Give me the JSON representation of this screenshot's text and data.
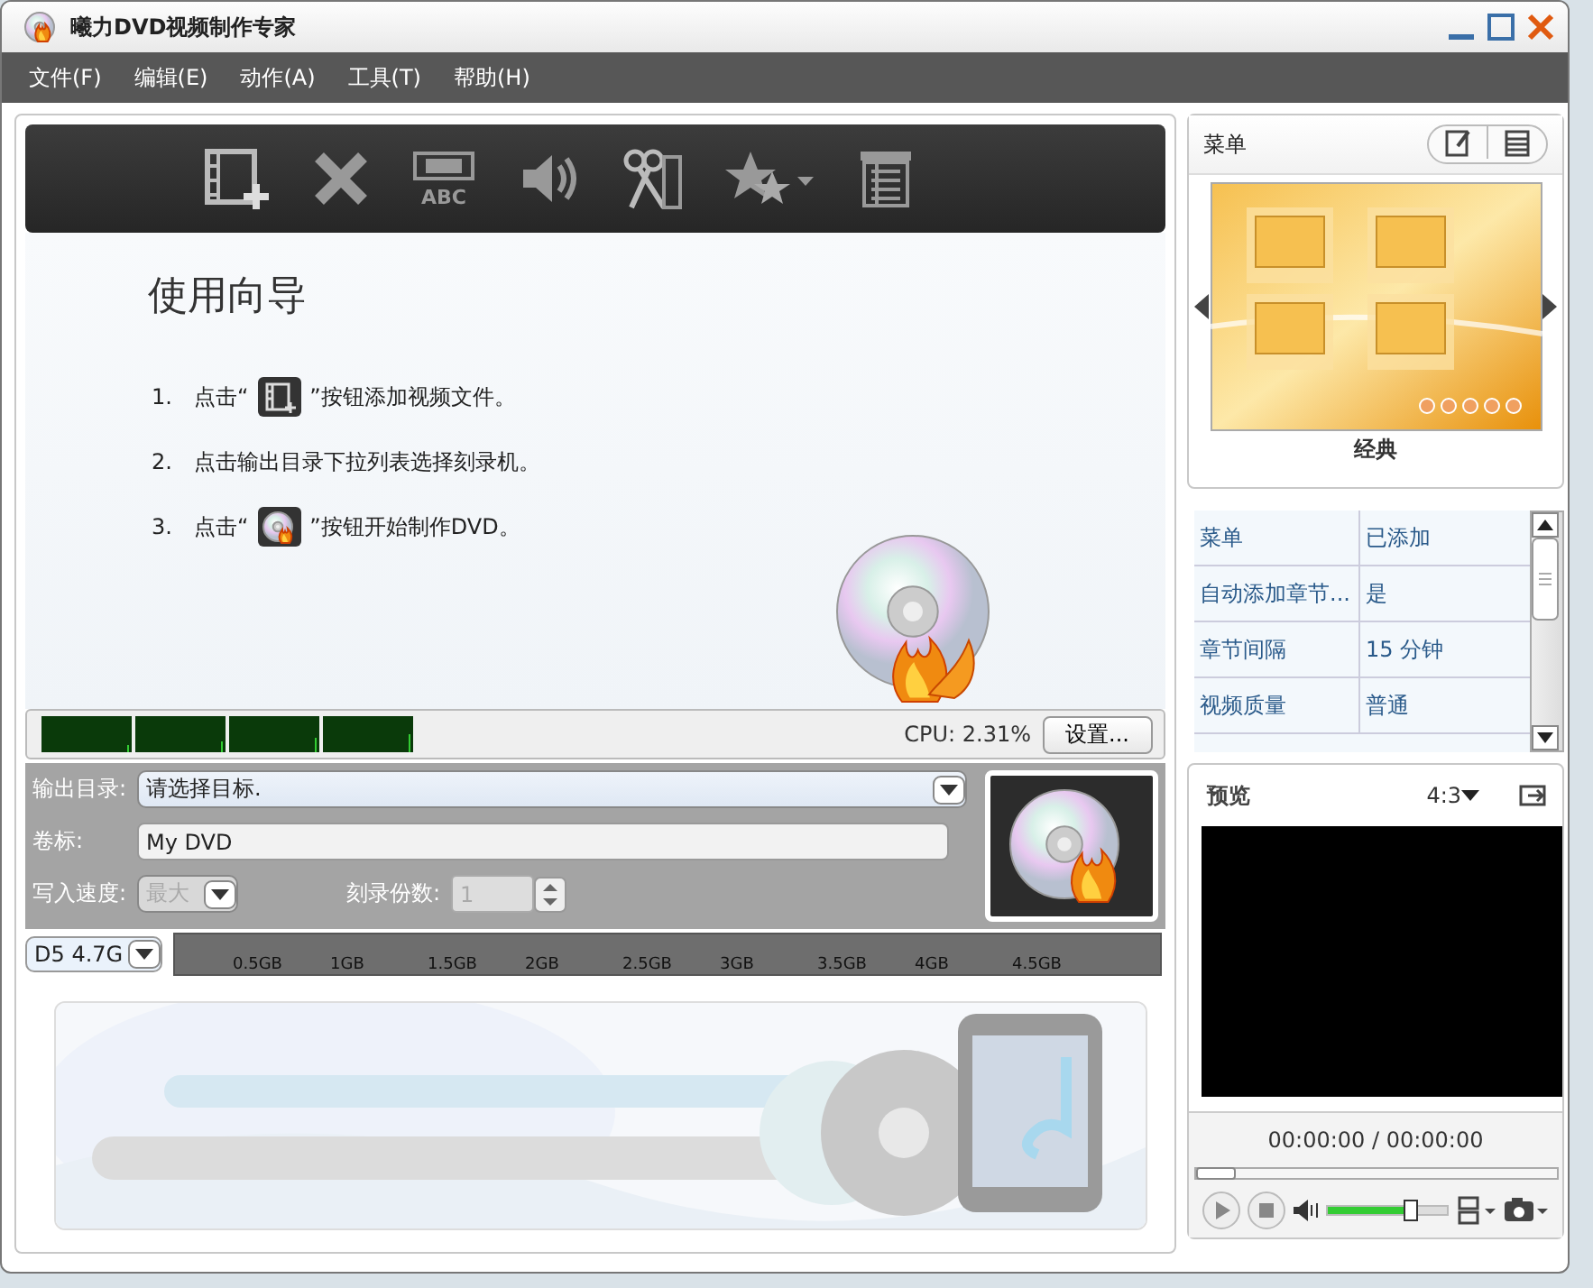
{
  "window": {
    "title": "曦力DVD视频制作专家"
  },
  "menu_bar": [
    {
      "label": "文件(F)"
    },
    {
      "label": "编辑(E)"
    },
    {
      "label": "动作(A)"
    },
    {
      "label": "工具(T)"
    },
    {
      "label": "帮助(H)"
    }
  ],
  "wizard": {
    "title": "使用向导",
    "steps": [
      {
        "number": "1.",
        "kind": "button",
        "before": "点击“",
        "after": "”按钮添加视频文件。"
      },
      {
        "number": "2.",
        "kind": "text",
        "before": "点击输出目录下拉列表选择刻录机。"
      },
      {
        "number": "3.",
        "kind": "button",
        "before": "点击“",
        "after": "”按钮开始制作DVD。"
      }
    ]
  },
  "toolbar": {
    "subtitle_label": "ABC"
  },
  "cpu": {
    "reading": "CPU: 2.31%",
    "button": "设置..."
  },
  "output": {
    "dir_label": "输出目录:",
    "dir_value": "请选择目标.",
    "volume_label": "卷标:",
    "volume_value": "My DVD",
    "speed_label": "写入速度:",
    "speed_value": "最大",
    "speed_disabled": true,
    "copies_label": "刻录份数:",
    "copies_value": "1",
    "copies_disabled": true
  },
  "disc": {
    "type": "D5 4.7G",
    "ticks": [
      "0.5GB",
      "1GB",
      "1.5GB",
      "2GB",
      "2.5GB",
      "3GB",
      "3.5GB",
      "4GB",
      "4.5GB"
    ]
  },
  "menu_panel": {
    "title": "菜单",
    "template": "经典"
  },
  "properties": [
    {
      "name": "菜单",
      "value": "已添加"
    },
    {
      "name": "自动添加章节...",
      "value": "是"
    },
    {
      "name": "章节间隔",
      "value": "15 分钟"
    },
    {
      "name": "视频质量",
      "value": "普通"
    }
  ],
  "preview": {
    "title": "预览",
    "aspect": "4:3",
    "time": "00:00:00 / 00:00:00",
    "seek": {
      "level": 0
    },
    "volume": {
      "level": 0.7
    }
  }
}
